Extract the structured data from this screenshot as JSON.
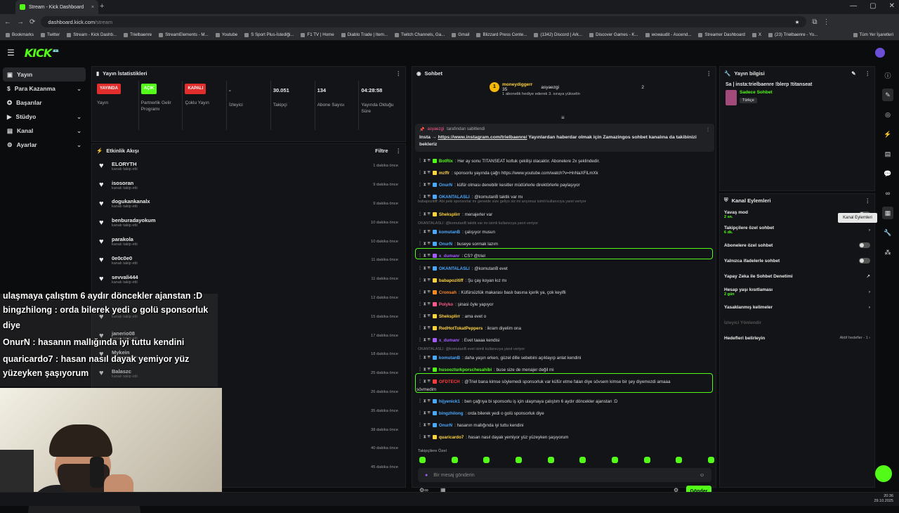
{
  "browser": {
    "tab_title": "Stream - Kick Dashboard",
    "url_prefix": "dashboard.kick.com",
    "url_path": "/stream"
  },
  "bookmarks": [
    "Bookmarks",
    "Twitter",
    "Stream - Kick Dashb...",
    "Trielbaenre",
    "StreamElements - M...",
    "Youtube",
    "S Sport Plus-İstediği...",
    "F1 TV | Home",
    "Diablo Trade | Item...",
    "Twitch Channels, Ga...",
    "Gmail",
    "Blizzard Press Cente...",
    "(1342) Discord | Ark...",
    "Discover Games - K...",
    "wowaudit - Ascend...",
    "Streamer Dashboard",
    "X",
    "(23) Trielbaenre - Yo...",
    "Tüm Yer İşaretleri"
  ],
  "kick": {
    "logo": "KICK",
    "logo_tag": "BETA"
  },
  "sidebar": [
    {
      "label": "Yayın",
      "chev": ""
    },
    {
      "label": "Para Kazanma",
      "chev": "⌄"
    },
    {
      "label": "Başarılar",
      "chev": ""
    },
    {
      "label": "Stüdyo",
      "chev": "⌄"
    },
    {
      "label": "Kanal",
      "chev": "⌄"
    },
    {
      "label": "Ayarlar",
      "chev": "⌄"
    }
  ],
  "stats": {
    "title": "Yayın İstatistikleri",
    "items": [
      {
        "badge": "YAYINDA",
        "badge_color": "#e22d2d",
        "value": "",
        "label": "Yayın"
      },
      {
        "badge": "AÇIK",
        "badge_color": "#53fc18",
        "value": "",
        "label": "Partnerlik Gelir Programı"
      },
      {
        "badge": "KAPALI",
        "badge_color": "#e22d2d",
        "value": "",
        "label": "Çoklu Yayın"
      },
      {
        "badge": "",
        "badge_color": "",
        "value": "-",
        "label": "İzleyici"
      },
      {
        "badge": "",
        "badge_color": "",
        "value": "30.051",
        "label": "Takipçi"
      },
      {
        "badge": "",
        "badge_color": "",
        "value": "134",
        "label": "Abone Sayısı"
      },
      {
        "badge": "",
        "badge_color": "",
        "value": "04:28:58",
        "label": "Yayında Olduğu Süre"
      }
    ]
  },
  "activity": {
    "title": "Etkinlik Akışı",
    "filter": "Filtre",
    "items": [
      {
        "name": "ELORYTH",
        "sub": "kanalı takip etti",
        "time": "1 dakika önce"
      },
      {
        "name": "isosoran",
        "sub": "kanalı takip etti",
        "time": "9 dakika önce"
      },
      {
        "name": "dogukankanalx",
        "sub": "kanalı takip etti",
        "time": "9 dakika önce"
      },
      {
        "name": "benburadayokum",
        "sub": "kanalı takip etti",
        "time": "10 dakika önce"
      },
      {
        "name": "parakola",
        "sub": "kanalı takip etti",
        "time": "10 dakika önce"
      },
      {
        "name": "0e0c0e0",
        "sub": "kanalı takip etti",
        "time": "11 dakika önce"
      },
      {
        "name": "sevvali444",
        "sub": "kanalı takip etti",
        "time": "11 dakika önce"
      },
      {
        "name": "",
        "sub": "kanalı takip etti",
        "time": "12 dakika önce"
      },
      {
        "name": "",
        "sub": "kanalı takip etti",
        "time": "15 dakika önce"
      },
      {
        "name": "janerio08",
        "sub": "kanalı takip etti",
        "time": "17 dakika önce"
      },
      {
        "name": "Mykein",
        "sub": "kanalı takip etti",
        "time": "18 dakika önce"
      },
      {
        "name": "Balaszc",
        "sub": "kanalı takip etti",
        "time": "25 dakika önce"
      },
      {
        "name": "",
        "sub": "",
        "time": "26 dakika önce"
      },
      {
        "name": "",
        "sub": "",
        "time": "35 dakika önce"
      },
      {
        "name": "",
        "sub": "",
        "time": "38 dakika önce"
      },
      {
        "name": "",
        "sub": "",
        "time": "40 dakika önce"
      },
      {
        "name": "",
        "sub": "",
        "time": "45 dakika önce"
      },
      {
        "name": "",
        "sub": "",
        "time": ""
      }
    ]
  },
  "chat": {
    "title": "Sohbet",
    "gift": {
      "user": "moneydiggerr",
      "to": "asyaezgi",
      "count": "35",
      "right_count": "2",
      "text": "1 abonelik hediye ederek 3. sıraya yükselin"
    },
    "pinned": {
      "by": "asyaezgi",
      "by_suffix": "tarafından sabitlendi",
      "text_a": "Insta → ",
      "link": "https://www.instagram.com/trielbaenre/",
      "text_b": " Yayınlardan haberdar olmak için Zamazingos sohbet kanalına da takibinizi bekleriz"
    },
    "messages": [
      {
        "user": "BotRix",
        "color": "#53fc18",
        "text": ": Her ay sonu TITANSEAT koltuk çekilişi olacaktır. Abonelere 2x şeklindedir."
      },
      {
        "user": "mzffr",
        "color": "#ffd23f",
        "text": ": sponsorlu yayında çağrı https://www.youtube.com/watch?v=HnNaXFlLmXk"
      },
      {
        "user": "OnurN",
        "color": "#4aa8ff",
        "text": ": küfür olması denebilir kesitler müdürlerle direktörlerle paylaşıyor"
      },
      {
        "user": "OKANTALASLI",
        "color": "#4aa8ff",
        "text": ": @komutanB taktik var mı"
      },
      {
        "user": "Sheksplirr",
        "color": "#ffd23f",
        "text": ": menajerler var"
      },
      {
        "user": "komutanB",
        "color": "#4aa8ff",
        "text": ": çalışıyor musun"
      },
      {
        "user": "OnurN",
        "color": "#4aa8ff",
        "text": ": buseye sormak lazım"
      },
      {
        "user": "x_dumanr",
        "color": "#a55cff",
        "text": ": CS? @triel"
      },
      {
        "user": "OKANTALASLI",
        "color": "#4aa8ff",
        "text": ": @komutanB evet"
      },
      {
        "user": "babapozitiff",
        "color": "#ffd23f",
        "text": ": Şu çay koyan kız mı"
      },
      {
        "user": "Cronsah",
        "color": "#ff8a2a",
        "text": ": Küfürsüzlük makarası baslı basına içerik ya, çok keyifli"
      },
      {
        "user": "Polyko",
        "color": "#ff5c8a",
        "text": ": şinasi öyle yapıyor"
      },
      {
        "user": "Sheksplirr",
        "color": "#ffd23f",
        "text": ": ama evet o"
      },
      {
        "user": "RedHotTokatPeppers",
        "color": "#ffd23f",
        "text": ": ikram diyelim ona"
      },
      {
        "user": "x_dumanr",
        "color": "#a55cff",
        "text": ": Evet taaaa kendisi"
      },
      {
        "user": "komutanB",
        "color": "#4aa8ff",
        "text": ": daha yaşın erken, güzel dille sebebini açıklayıp anlat kendini"
      },
      {
        "user": "husoozturkporschesahibi",
        "color": "#53fc18",
        "text": ": buse size de menajer değil mi"
      },
      {
        "user": "OFDTECH",
        "color": "#ff3b3b",
        "text": ": @Triel bana kimse söylemedi sponsorluk var küfür etme falan diye sövsem kimse bir şey diyemezdi amaaa"
      },
      {
        "user": "hijyenick1",
        "color": "#4aa8ff",
        "text": ": ben çağrıya bi sponsorlu iş için ulaşmaya çalıştım 6 aydır döncekler ajanstan :D"
      },
      {
        "user": "bingzhilong",
        "color": "#4aa8ff",
        "text": ": orda bilerek yedi o golü sponsorluk diye"
      },
      {
        "user": "OnurN",
        "color": "#4aa8ff",
        "text": ": hasanın mallığında iyi tuttu kendini"
      },
      {
        "user": "quaricardo7",
        "color": "#ffd23f",
        "text": ": hasan nasıl dayak yemiyor yüz yüzeyken şaşıyorum"
      }
    ],
    "ofd_cont": "sövmedim",
    "system": [
      "babapozitiff: Abi peki sponsorlar mı geneide size geliyo siz mi arıyonuz isimli kullanıcıya yanıt veriyor",
      "OKANTALASLI: @komutanB taktik var mı isimli kullanıcıya yanıt veriyor",
      "OKANTALASLI: @komutanB evet isimli kullanıcıya yanıt veriyor"
    ],
    "followers_only": "Takipçilere Özel",
    "input_placeholder": "Bir mesaj gönderin",
    "send": "Gönder"
  },
  "info": {
    "title": "Yayın bilgisi",
    "stream_title": "Sa | insta:trielbaenre !blerp !titanseat",
    "category": "Sadece Sohbet",
    "language": "Türkçe"
  },
  "actions": {
    "title": "Kanal Eylemleri",
    "tooltip": "Kanal Eylemleri",
    "items": [
      {
        "label": "Yavaş mod",
        "sub": "2 sn.",
        "right": "toggle-on"
      },
      {
        "label": "Takipçilere özel sohbet",
        "sub": "6 dk.",
        "right": "›"
      },
      {
        "label": "Abonelere özel sohbet",
        "sub": "",
        "right": "toggle"
      },
      {
        "label": "Yalnızca ifadelerle sohbet",
        "sub": "",
        "right": "toggle"
      },
      {
        "label": "Yapay Zeka ile Sohbet Denetimi",
        "sub": "",
        "right": "↗"
      },
      {
        "label": "Hesap yaşı kısıtlaması",
        "sub": "2 gün",
        "right": "›"
      },
      {
        "label": "Yasaklanmış kelimeler",
        "sub": "",
        "right": "›"
      },
      {
        "label": "İzleyici Yönlendir",
        "sub": "",
        "right": ""
      },
      {
        "label": "Hedefleri belirleyin",
        "sub": "",
        "right": "Aktif hedefler - 1 ›"
      }
    ]
  },
  "overlay": [
    "ulaşmaya çalıştım 6 aydır döncekler ajanstan :D",
    "bingzhilong : orda bilerek yedi o golü sponsorluk",
    "diye",
    "OnurN : hasanın mallığında iyi tuttu kendini",
    "quaricardo7 : hasan nasıl dayak yemiyor yüz",
    "yüzeyken şaşıyorum"
  ],
  "clock": {
    "time": "20:36",
    "date": "29.10.2025"
  }
}
